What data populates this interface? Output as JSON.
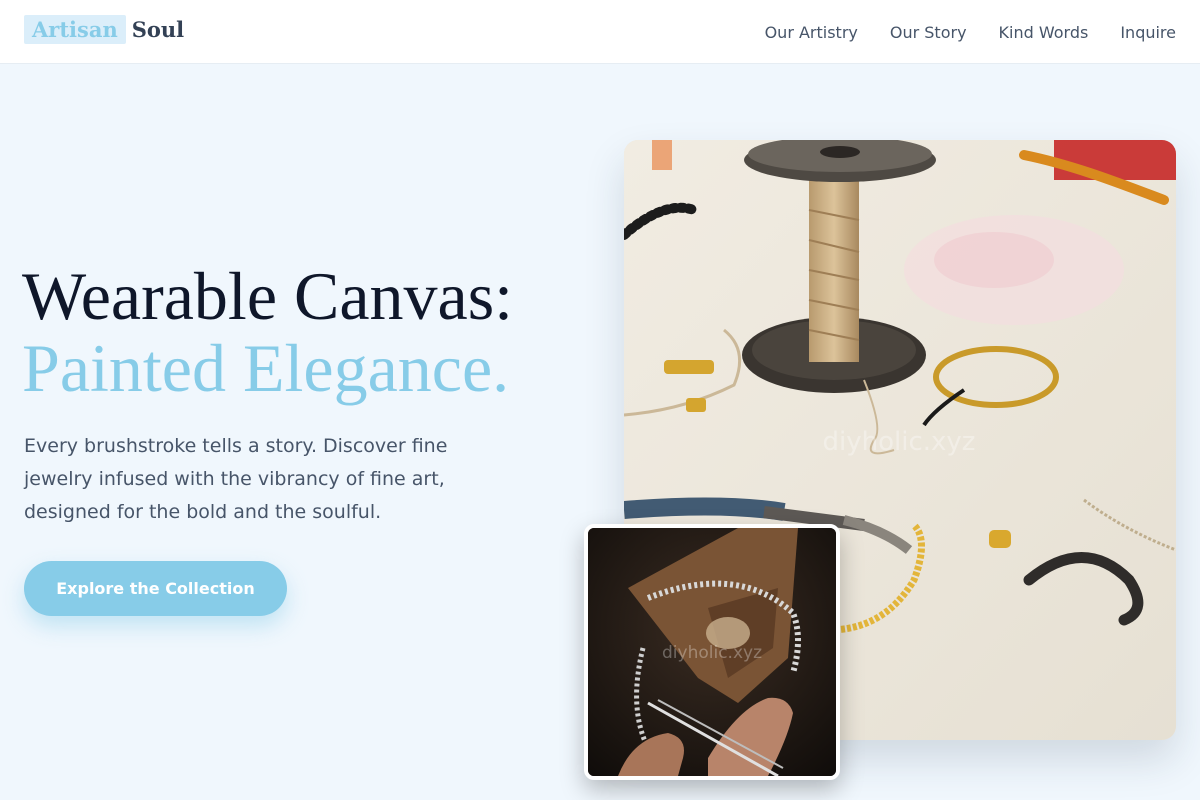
{
  "brand": {
    "part1": "Artisan",
    "part2": "Soul"
  },
  "nav": [
    {
      "label": "Our Artistry"
    },
    {
      "label": "Our Story"
    },
    {
      "label": "Kind Words"
    },
    {
      "label": "Inquire"
    }
  ],
  "hero": {
    "title_line1": "Wearable Canvas:",
    "title_line2": "Painted Elegance.",
    "subtitle": "Every brushstroke tells a story. Discover fine jewelry infused with the vibrancy of fine art, designed for the bold and the soulful.",
    "cta_label": "Explore the Collection"
  },
  "images": {
    "main_watermark": "diyholic.xyz",
    "inset_watermark": "diyholic.xyz"
  },
  "colors": {
    "accent": "#87cce8",
    "heading": "#0f172a",
    "body_text": "#475569",
    "background": "#f0f7fd"
  }
}
